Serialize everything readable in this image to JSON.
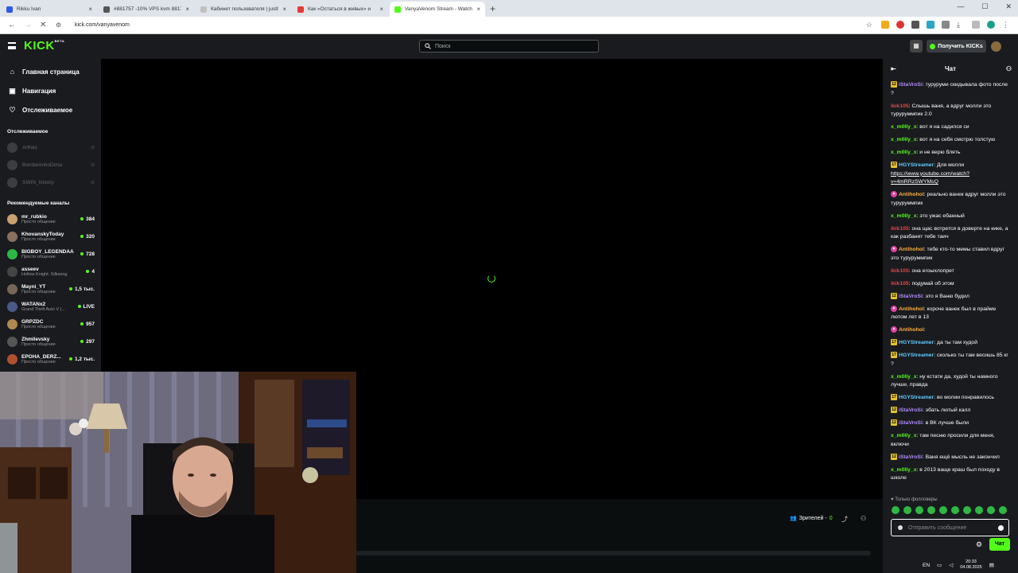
{
  "browser": {
    "tabs": [
      {
        "title": "Rikku Ivan",
        "color": "#2d5be3"
      },
      {
        "title": "#881757 -10% VPS kvm 88175",
        "color": "#555"
      },
      {
        "title": "Кабинет пользователя | justh",
        "color": "#c0c0c0"
      },
      {
        "title": "Как «Остаться в живых» и",
        "color": "#e53935"
      },
      {
        "title": "VanyaVenom Stream - Watch L",
        "color": "#53fc18",
        "active": true
      }
    ],
    "new_tab": "+",
    "url": "kick.com/vanyavenom"
  },
  "header": {
    "logo": "KICK",
    "logo_sup": "BETA",
    "search_placeholder": "Поиск",
    "kicks_button": "Получить KICKs"
  },
  "sidebar": {
    "nav": [
      {
        "label": "Главная страница",
        "icon": "home-icon",
        "glyph": "⌂"
      },
      {
        "label": "Навигация",
        "icon": "browse-icon",
        "glyph": "▣"
      },
      {
        "label": "Отслеживаемое",
        "icon": "heart-icon",
        "glyph": "♡"
      }
    ],
    "following_title": "Отслеживаемое",
    "following": [
      "Arthas",
      "BondarenkoDima",
      "SWIN_history"
    ],
    "recommended_title": "Рекомендуемые каналы",
    "recommended": [
      {
        "name": "mr_rubkio",
        "category": "Просто общение",
        "viewers": "384",
        "color": "#c9a070"
      },
      {
        "name": "KhovanskyToday",
        "category": "Просто общение",
        "viewers": "320",
        "color": "#8a7060"
      },
      {
        "name": "BIGBOY_LEGENDAA",
        "category": "Просто общение",
        "viewers": "728",
        "color": "#2eb843"
      },
      {
        "name": "asseev",
        "category": "Hollow Knight: Silksong",
        "viewers": "4",
        "color": "#444"
      },
      {
        "name": "Mayni_YT",
        "category": "Просто общение",
        "viewers": "1,5 тыс.",
        "color": "#776655"
      },
      {
        "name": "WATANx2",
        "category": "Grand Theft Auto V (...",
        "viewers": "LIVE",
        "color": "#4a5a88"
      },
      {
        "name": "GRPZDC",
        "category": "Просто общение",
        "viewers": "957",
        "color": "#b08850"
      },
      {
        "name": "Zhmilevsky",
        "category": "Просто общение",
        "viewers": "297",
        "color": "#555"
      },
      {
        "name": "EPOHA_DERZ...",
        "category": "Просто общение",
        "viewers": "1,2 тыс.",
        "color": "#b05030"
      }
    ]
  },
  "player": {
    "viewers_label": "Зрителей -",
    "viewers_count": "0"
  },
  "chat": {
    "title": "Чат",
    "messages": [
      {
        "badge": "12",
        "user": "iStaVroSi",
        "color": "#b38cff",
        "text": ": туруруми скидывала фото после ?"
      },
      {
        "badge": "",
        "user": "ikik105",
        "color": "#e04848",
        "text": ": Слышь ваня, а вдруг молли это туруруммпик 2.0"
      },
      {
        "badge": "",
        "user": "x_m0lly_x",
        "color": "#53fc18",
        "text": ": вот я на садился си"
      },
      {
        "badge": "",
        "user": "x_m0lly_x",
        "color": "#53fc18",
        "text": ": вот я на себя смотрю толстую"
      },
      {
        "badge": "",
        "user": "x_m0lly_x",
        "color": "#53fc18",
        "text": ": и не верю блять"
      },
      {
        "badge": "17",
        "user": "HGYStreamer",
        "color": "#62c8ff",
        "text": ": Для молли ",
        "link": "https://www.youtube.com/watch?v=4mRRzSWYMsQ"
      },
      {
        "badge": "pink",
        "user": "Antihohol",
        "color": "#ffb13b",
        "text": ": реально ванек вдруг молли это туруруммпик"
      },
      {
        "badge": "",
        "user": "x_m0lly_x",
        "color": "#53fc18",
        "text": ": это ужас ебанный"
      },
      {
        "badge": "",
        "user": "ikik105",
        "color": "#e04848",
        "text": ": она щас вотрется в доверте на кике, а как разбанят тебе таич"
      },
      {
        "badge": "pink",
        "user": "Antihohol",
        "color": "#ffb13b",
        "text": ": тебе кто-то мемы ставил вдруг это туруруммпик"
      },
      {
        "badge": "",
        "user": "ikik105",
        "color": "#e04848",
        "text": ": она егоыхлопрет"
      },
      {
        "badge": "",
        "user": "ikik105",
        "color": "#e04848",
        "text": ": подумай об этом"
      },
      {
        "badge": "12",
        "user": "iStaVroSi",
        "color": "#b38cff",
        "text": ": это я Ваню будил"
      },
      {
        "badge": "pink",
        "user": "Antihohol",
        "color": "#ffb13b",
        "text": ": короче ванек был в прайме лютом лет в 13"
      },
      {
        "badge": "pink",
        "user": "Antihohol",
        "color": "#ffb13b",
        "text": ":"
      },
      {
        "badge": "17",
        "user": "HGYStreamer",
        "color": "#62c8ff",
        "text": ": да ты там худой"
      },
      {
        "badge": "17",
        "user": "HGYStreamer",
        "color": "#62c8ff",
        "text": ": сколько ты там весишь 85 кг ?"
      },
      {
        "badge": "",
        "user": "x_m0lly_x",
        "color": "#53fc18",
        "text": ": ну кстати да, худой ты намного лучше, правда"
      },
      {
        "badge": "17",
        "user": "HGYStreamer",
        "color": "#62c8ff",
        "text": ": во молии понравилось"
      },
      {
        "badge": "12",
        "user": "iStaVroSi",
        "color": "#b38cff",
        "text": ": эбать лютый калл"
      },
      {
        "badge": "12",
        "user": "iStaVroSi",
        "color": "#b38cff",
        "text": ": в ВК лучше были"
      },
      {
        "badge": "",
        "user": "x_m0lly_x",
        "color": "#53fc18",
        "text": ": там песню просили для меня, включи"
      },
      {
        "badge": "12",
        "user": "iStaVroSi",
        "color": "#b38cff",
        "text": ": Ваня ещё мысль не закончил"
      },
      {
        "badge": "",
        "user": "x_m0lly_x",
        "color": "#53fc18",
        "text": ": в 2013 ваще краш был походу в школе"
      }
    ],
    "followers_only": "♥ Только фолловеры",
    "input_placeholder": "Отправить сообщение",
    "send_label": "Чат"
  },
  "tray": {
    "lang": "EN",
    "time": "20:33",
    "date": "04.08.2025"
  }
}
